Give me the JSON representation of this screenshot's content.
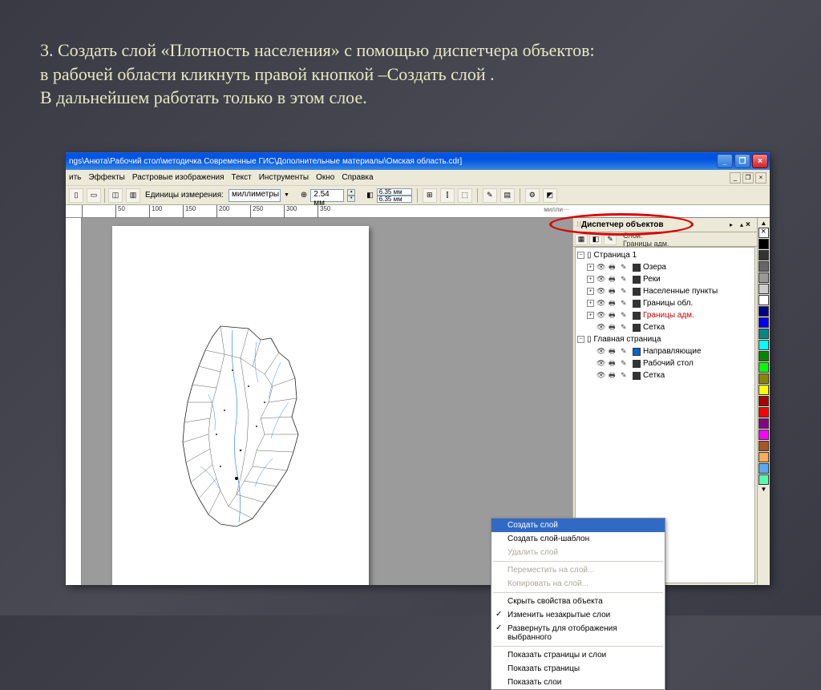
{
  "slide": {
    "line1": "3. Создать слой «Плотность населения» с помощью диспетчера объектов:",
    "line2": "в рабочей области кликнуть правой кнопкой –Создать слой .",
    "line3": "В дальнейшем работать только в этом слое."
  },
  "titlebar": {
    "path": "ngs\\Анюта\\Рабочий стол\\методичка Современные ГИС\\Дополнительные материалы\\Омская область.cdr]"
  },
  "menu": {
    "items": [
      "ить",
      "Эффекты",
      "Растровые изображения",
      "Текст",
      "Инструменты",
      "Окно",
      "Справка"
    ]
  },
  "toolbar": {
    "units_label": "Единицы измерения:",
    "units_value": "миллиметры",
    "nudge": "2.54 мм",
    "dup_x": "6.35 мм",
    "dup_y": "6.35 мм"
  },
  "ruler": {
    "ticks": [
      "",
      "50",
      "100",
      "150",
      "200",
      "250",
      "300",
      "350"
    ],
    "cutoff": "милли···"
  },
  "docker": {
    "title": "Диспетчер объектов",
    "info_line1": "Слои:",
    "info_line2": "Границы адм.",
    "page1": "Страница 1",
    "layers": [
      {
        "name": "Озера",
        "color": "#333"
      },
      {
        "name": "Реки",
        "color": "#333"
      },
      {
        "name": "Населенные пункты",
        "color": "#333"
      },
      {
        "name": "Границы обл.",
        "color": "#333"
      },
      {
        "name": "Границы адм.",
        "color": "#333",
        "selected": true
      },
      {
        "name": "Сетка",
        "color": "#333"
      }
    ],
    "master": "Главная страница",
    "master_layers": [
      {
        "name": "Направляющие",
        "color": "#06c"
      },
      {
        "name": "Рабочий стол",
        "color": "#333"
      },
      {
        "name": "Сетка",
        "color": "#333"
      }
    ]
  },
  "context_menu": {
    "items": [
      {
        "label": "Создать слой",
        "selected": true
      },
      {
        "label": "Создать слой-шаблон"
      },
      {
        "label": "Удалить слой",
        "disabled": true
      },
      {
        "sep": true
      },
      {
        "label": "Переместить на слой...",
        "disabled": true
      },
      {
        "label": "Копировать на слой...",
        "disabled": true
      },
      {
        "sep": true
      },
      {
        "label": "Скрыть свойства объекта"
      },
      {
        "label": "Изменить незакрытые слои",
        "check": true
      },
      {
        "label": "Развернуть для отображения выбранного",
        "check": true
      },
      {
        "sep": true
      },
      {
        "label": "Показать страницы и слои"
      },
      {
        "label": "Показать страницы"
      },
      {
        "label": "Показать слои"
      }
    ]
  },
  "palette": [
    "none",
    "#000",
    "#fff",
    "#00a",
    "#0aa",
    "#0a0",
    "#a0a",
    "#a00",
    "#aa0",
    "#008",
    "#088",
    "#080",
    "#808",
    "#800",
    "#880",
    "#888",
    "#ccc",
    "#44f",
    "#4ff",
    "#4f4",
    "#f4f",
    "#f44",
    "#ff4"
  ]
}
